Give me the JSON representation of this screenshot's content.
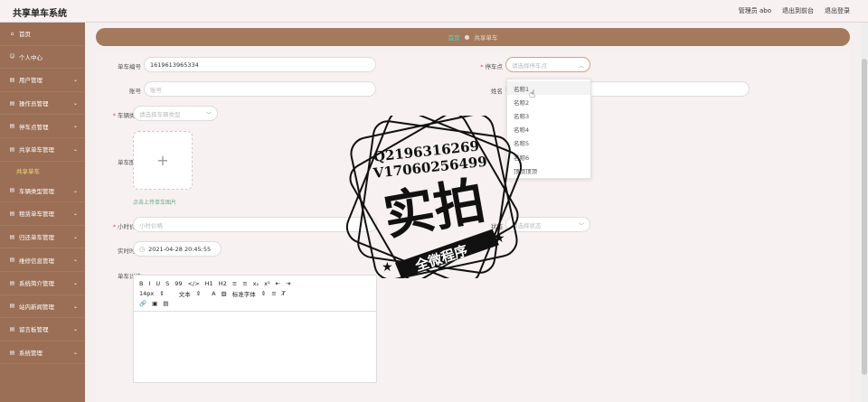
{
  "app": {
    "title": "共享单车系统"
  },
  "top_links": [
    "管理员 abo",
    "退出到前台",
    "退出登录"
  ],
  "sidebar": {
    "items": [
      {
        "label": "首页",
        "icon": "home-icon"
      },
      {
        "label": "个人中心",
        "icon": "user-icon"
      },
      {
        "label": "用户管理",
        "icon": "list-icon"
      },
      {
        "label": "操作员管理",
        "icon": "list-icon"
      },
      {
        "label": "停车点管理",
        "icon": "list-icon"
      },
      {
        "label": "共享单车管理",
        "icon": "list-icon"
      },
      {
        "label": "共享单车",
        "sub": true
      },
      {
        "label": "车辆类型管理",
        "icon": "list-icon"
      },
      {
        "label": "租赁单车管理",
        "icon": "list-icon"
      },
      {
        "label": "归还单车管理",
        "icon": "list-icon"
      },
      {
        "label": "维修信息管理",
        "icon": "list-icon"
      },
      {
        "label": "系统简介管理",
        "icon": "list-icon"
      },
      {
        "label": "站内新闻管理",
        "icon": "list-icon"
      },
      {
        "label": "留言板管理",
        "icon": "list-icon"
      },
      {
        "label": "系统管理",
        "icon": "list-icon"
      }
    ]
  },
  "breadcrumb": {
    "home": "首页",
    "current": "共享单车"
  },
  "form": {
    "bike_no_label": "单车编号",
    "bike_no_value": "1619613965334",
    "parking_label": "停车点",
    "parking_placeholder": "请选择停车点",
    "account_label": "账号",
    "account_placeholder": "账号",
    "name_label": "姓名",
    "type_label": "车辆类型",
    "type_placeholder": "请选择车辆类型",
    "image_label": "单车图片",
    "upload_tip": "点击上传单车图片",
    "hourly_label": "小时价格",
    "hourly_placeholder": "小时价格",
    "status_label": "状态",
    "status_placeholder": "请选择状态",
    "time_label": "实时时间",
    "time_value": "2021-04-28 20:45:55",
    "detail_label": "单车详情"
  },
  "dropdown": {
    "options": [
      "名称1",
      "名称2",
      "名称3",
      "名称4",
      "名称5",
      "名称6",
      "顶顶顶顶"
    ]
  },
  "editor": {
    "row1": [
      "B",
      "I",
      "U",
      "S",
      "99",
      "</>",
      "H1",
      "H2",
      "≡",
      "≡",
      "x₂",
      "x²",
      "⇤",
      "⇥"
    ],
    "font_size": "14px",
    "text_style": "文本",
    "font_family": "标准字体"
  },
  "stamp": {
    "line1": "Q2196316269",
    "line2": "V17060256499",
    "big": "实拍",
    "ribbon": "全微程序"
  }
}
